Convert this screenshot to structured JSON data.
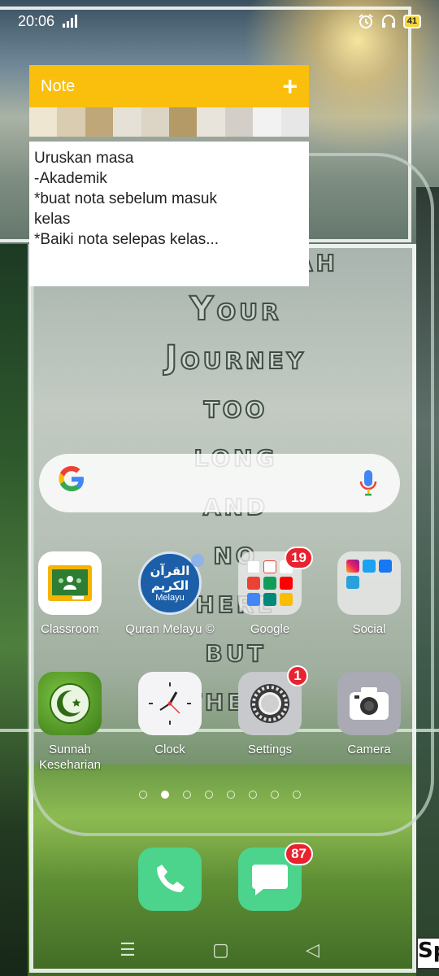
{
  "status_bar": {
    "time": "20:06",
    "battery": "41"
  },
  "note_widget": {
    "title": "Note",
    "add_symbol": "+",
    "lines": [
      "Uruskan masa",
      "-Akademik",
      "*buat nota sebelum masuk",
      "kelas",
      "*Baiki nota selepas kelas..."
    ]
  },
  "wallpaper": {
    "quote_lines": [
      "Muhasabah",
      "Your",
      "Journey",
      "too",
      "long",
      "and",
      "no",
      "here",
      "but",
      "there"
    ]
  },
  "search": {
    "logo": "G"
  },
  "apps_row1": [
    {
      "label": "Classroom"
    },
    {
      "label": "Quran Melayu ©",
      "icon_text": "القرآن الكريم",
      "icon_sub": "Melayu"
    },
    {
      "label": "Google",
      "badge": "19"
    },
    {
      "label": "Social"
    }
  ],
  "apps_row2": [
    {
      "label": "Sunnah Keseharian"
    },
    {
      "label": "Clock"
    },
    {
      "label": "Settings",
      "badge": "1"
    },
    {
      "label": "Camera"
    }
  ],
  "dock": {
    "messages_badge": "87"
  },
  "page_indicator": {
    "count": 8,
    "active_index": 1
  },
  "nav_bar": {
    "menu": "☰",
    "home": "▢",
    "back": "◁"
  },
  "corner_tag": "Sp"
}
